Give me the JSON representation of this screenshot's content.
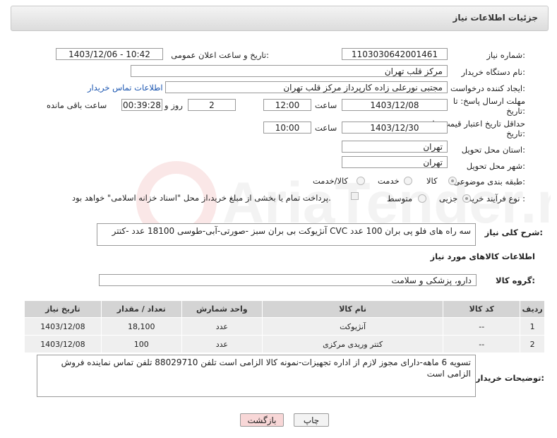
{
  "header": {
    "title": "جزئیات اطلاعات نیاز"
  },
  "fields": {
    "need_number_label": "شماره نیاز:",
    "need_number": "1103030642001461",
    "announce_label": "تاریخ و ساعت اعلان عمومی:",
    "announce_value": "1403/12/06 - 10:42",
    "buyer_org_label": "نام دستگاه خریدار:",
    "buyer_org": "مرکز قلب تهران",
    "requester_label": "ایجاد کننده درخواست:",
    "requester": "مجتبی نورعلی زاده کارپرداز مرکز قلب تهران",
    "contact_link": "اطلاعات تماس خریدار",
    "reply_deadline_label_1": "مهلت ارسال پاسخ: تا",
    "reply_deadline_label_2": "تاریخ:",
    "reply_date": "1403/12/08",
    "time_label": "ساعت",
    "reply_time": "12:00",
    "days_value": "2",
    "days_label": "روز و",
    "remaining_time": "00:39:28",
    "remaining_label": "ساعت باقی مانده",
    "price_validity_label_1": "حداقل تاریخ اعتبار قیمت: تا",
    "price_validity_label_2": "تاریخ:",
    "price_date": "1403/12/30",
    "price_time_label": "ساعت",
    "price_time": "10:00",
    "province_label": "استان محل تحویل:",
    "province": "تهران",
    "city_label": "شهر محل تحویل:",
    "city": "تهران",
    "category_label": "طبقه بندی موضوعی:",
    "category_options": [
      "کالا",
      "خدمت",
      "کالا/خدمت"
    ],
    "process_label": "نوع فرآیند خرید :",
    "process_options": [
      "جزیی",
      "متوسط"
    ],
    "payment_note": "پرداخت تمام یا بخشی از مبلغ خرید،از محل \"اسناد خزانه اسلامی\" خواهد بود.",
    "description_label": "شرح کلی نیاز:",
    "description": "آنژیوکت بی بران سبز -صورتی-آبی-طوسی 18100 عدد -کتتر CVC سه راه های فلو پی بران 100 عدد",
    "goods_info_title": "اطلاعات کالاهای مورد نیاز",
    "goods_group_label": "گروه کالا:",
    "goods_group": "دارو، پزشکی و سلامت"
  },
  "table": {
    "headers": [
      "ردیف",
      "کد کالا",
      "نام کالا",
      "واحد شمارش",
      "تعداد / مقدار",
      "تاریخ نیاز"
    ],
    "rows": [
      [
        "1",
        "--",
        "آنژیوکت",
        "عدد",
        "18,100",
        "1403/12/08"
      ],
      [
        "2",
        "--",
        "کتتر وریدی مرکزی",
        "عدد",
        "100",
        "1403/12/08"
      ]
    ]
  },
  "buyer_notes_label": "توضیحات خریدار:",
  "buyer_notes": "تسویه 6 ماهه-دارای مجوز لازم از اداره تجهیزات-نمونه کالا الزامی است تلفن 88029710 تلفن تماس نماینده فروش الزامی است",
  "buttons": {
    "print": "چاپ",
    "back": "بازگشت"
  },
  "colors": {
    "link": "#1a55b0",
    "back_button_bg": "#f8d7d7",
    "header_bg": "#e2e2e2",
    "table_header_bg": "#d4d4d4"
  }
}
